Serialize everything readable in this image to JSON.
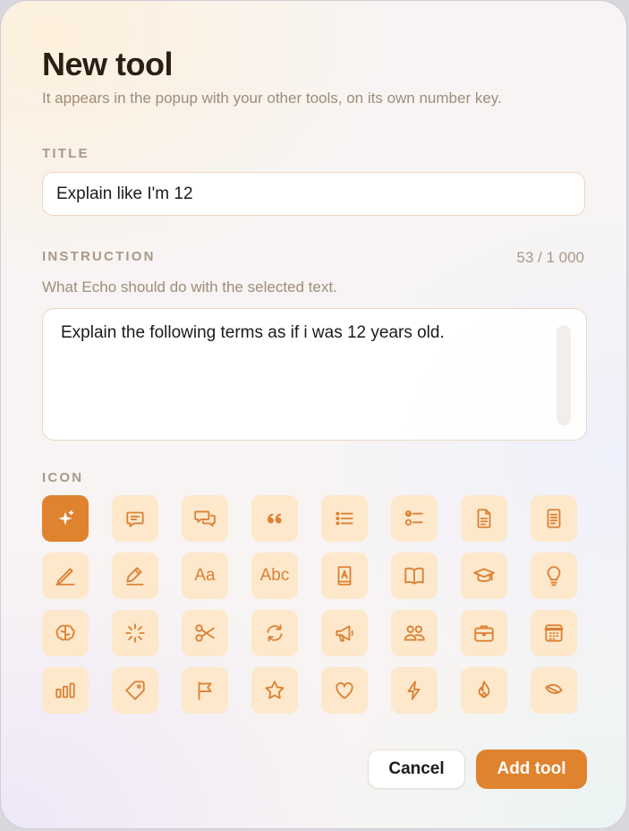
{
  "dialog": {
    "title": "New tool",
    "subtitle": "It appears in the popup with your other tools, on its own number key."
  },
  "title_field": {
    "label": "TITLE",
    "value": "Explain like I'm 12"
  },
  "instruction_field": {
    "label": "INSTRUCTION",
    "counter": "53 / 1 000",
    "hint": "What Echo should do with the selected text.",
    "value": "Explain the following terms as if i was 12 years old."
  },
  "icon_picker": {
    "label": "ICON",
    "selected": "sparkles-icon",
    "icons": [
      "sparkles-icon",
      "chat-bubble-icon",
      "chat-bubbles-icon",
      "quote-icon",
      "list-icon",
      "checklist-icon",
      "document-icon",
      "note-icon",
      "pen-icon",
      "pencil-icon",
      "font-aa-icon",
      "font-abc-icon",
      "book-a-icon",
      "open-book-icon",
      "graduation-cap-icon",
      "lightbulb-icon",
      "brain-icon",
      "burst-icon",
      "scissors-icon",
      "refresh-icon",
      "megaphone-icon",
      "people-icon",
      "briefcase-icon",
      "calendar-icon",
      "bar-chart-icon",
      "tag-icon",
      "flag-icon",
      "star-icon",
      "heart-icon",
      "bolt-icon",
      "flame-icon",
      "leaf-icon"
    ],
    "text_icons": {
      "font-aa-icon": "Aa",
      "font-abc-icon": "Abc"
    }
  },
  "actions": {
    "cancel_label": "Cancel",
    "add_label": "Add tool"
  },
  "colors": {
    "accent": "#e0832f",
    "tile_background": "#fde8cb",
    "icon_color": "#dc8134"
  }
}
